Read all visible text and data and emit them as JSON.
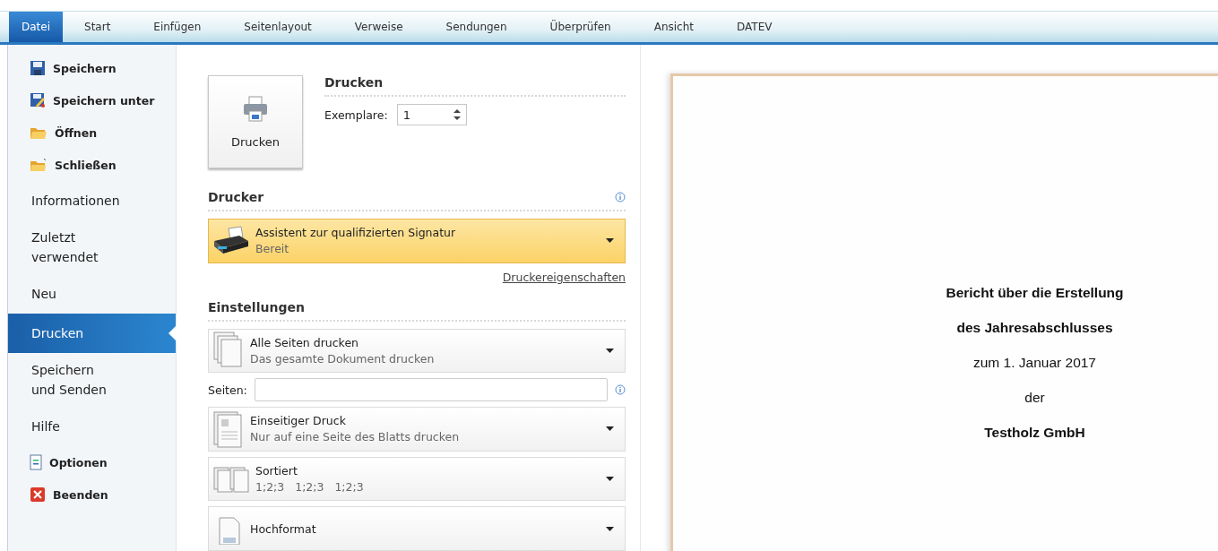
{
  "ribbon_tabs": [
    {
      "label": "Datei",
      "selected": true
    },
    {
      "label": "Start",
      "selected": false
    },
    {
      "label": "Einfügen",
      "selected": false
    },
    {
      "label": "Seitenlayout",
      "selected": false
    },
    {
      "label": "Verweise",
      "selected": false
    },
    {
      "label": "Sendungen",
      "selected": false
    },
    {
      "label": "Überprüfen",
      "selected": false
    },
    {
      "label": "Ansicht",
      "selected": false
    },
    {
      "label": "DATEV",
      "selected": false
    }
  ],
  "sidebar": {
    "items": [
      {
        "kind": "command",
        "label": "Speichern",
        "selected": false
      },
      {
        "kind": "command",
        "label": "Speichern unter",
        "selected": false
      },
      {
        "kind": "command",
        "label": "Öffnen",
        "selected": false
      },
      {
        "kind": "command",
        "label": "Schließen",
        "selected": false
      },
      {
        "kind": "section",
        "label": "Informationen",
        "selected": false
      },
      {
        "kind": "section",
        "label": "Zuletzt verwendet",
        "selected": false
      },
      {
        "kind": "section",
        "label": "Neu",
        "selected": false
      },
      {
        "kind": "section",
        "label": "Drucken",
        "selected": true
      },
      {
        "kind": "section",
        "label": "Speichern und Senden",
        "selected": false
      },
      {
        "kind": "section",
        "label": "Hilfe",
        "selected": false
      },
      {
        "kind": "command",
        "label": "Optionen",
        "selected": false
      },
      {
        "kind": "command",
        "label": "Beenden",
        "selected": false
      }
    ]
  },
  "print": {
    "button": "Drucken",
    "heading": "Drucken",
    "copies_label": "Exemplare:",
    "copies_value": "1"
  },
  "printer": {
    "heading": "Drucker",
    "name": "Assistent zur qualifizierten Signatur",
    "status": "Bereit",
    "properties_link": "Druckereigenschaften"
  },
  "settings": {
    "heading": "Einstellungen",
    "options": [
      {
        "title": "Alle Seiten drucken",
        "subtitle": "Das gesamte Dokument drucken"
      },
      {
        "title": "Einseitiger Druck",
        "subtitle": "Nur auf eine Seite des Blatts drucken"
      },
      {
        "title": "Sortiert",
        "subtitle": "1;2;3   1;2;3   1;2;3"
      },
      {
        "title": "Hochformat"
      }
    ],
    "pages_label": "Seiten:"
  },
  "preview": {
    "lines": [
      {
        "text": "Bericht über die Erstellung",
        "bold": true
      },
      {
        "text": "des Jahresabschlusses",
        "bold": true
      },
      {
        "text": "zum 1. Januar 2017",
        "bold": false
      },
      {
        "text": "der",
        "bold": false
      },
      {
        "text": "Testholz GmbH",
        "bold": true
      }
    ]
  }
}
